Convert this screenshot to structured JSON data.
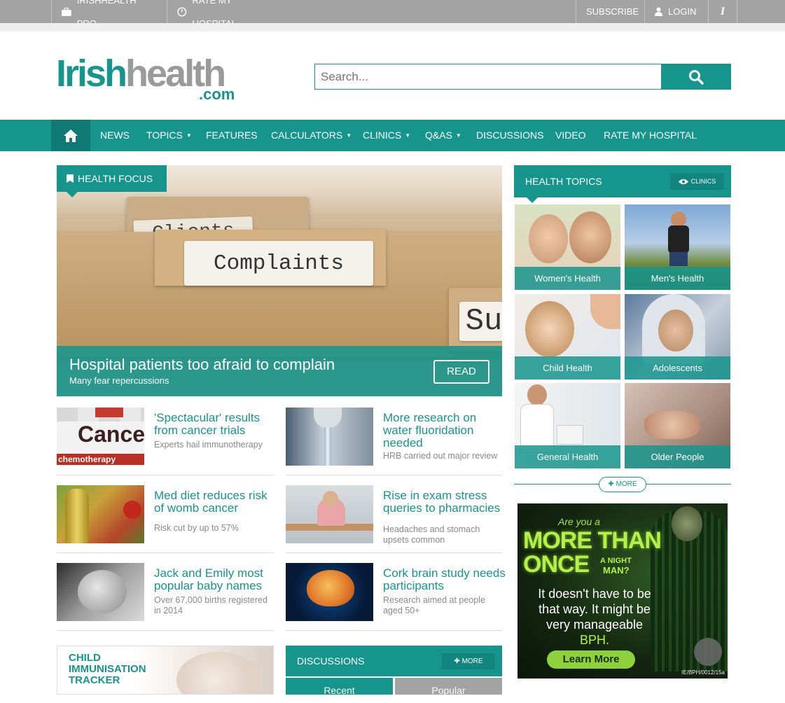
{
  "topbar": {
    "pro_label": "IRISHHEALTH PRO",
    "rate_label": "RATE MY HOSPITAL",
    "subscribe_label": "SUBSCRIBE",
    "login_label": "LOGIN",
    "info_label": "i"
  },
  "logo": {
    "part1": "Irish",
    "part2": "health",
    "dotcom": ".com"
  },
  "search": {
    "placeholder": "Search..."
  },
  "nav": {
    "items": [
      "NEWS",
      "TOPICS",
      "FEATURES",
      "CALCULATORS",
      "CLINICS",
      "Q&As",
      "DISCUSSIONS",
      "VIDEO",
      "RATE MY HOSPITAL"
    ]
  },
  "hero": {
    "badge": "HEALTH FOCUS",
    "folder_main": "Complaints",
    "folder_back": "Clients",
    "folder_side": "Su",
    "title": "Hospital patients too afraid to complain",
    "subtitle": "Many fear repercussions",
    "read_label": "READ"
  },
  "stories": [
    {
      "title": "'Spectacular' results from cancer trials",
      "sub": "Experts hail immunotherapy"
    },
    {
      "title": "More research on water fluoridation needed",
      "sub": "HRB carried out major review"
    },
    {
      "title": "Med diet reduces risk of womb cancer",
      "sub": "Risk cut by up to 57%"
    },
    {
      "title": "Rise in exam stress queries to pharmacies",
      "sub": "Headaches and stomach upsets common"
    },
    {
      "title": "Jack and Emily most popular baby names",
      "sub": "Over 67,000 births registered in 2014"
    },
    {
      "title": "Cork brain study needs participants",
      "sub": "Research aimed at people aged 50+"
    }
  ],
  "thumb_text": {
    "cancer": "Cancer",
    "chemo": "chemotherapy"
  },
  "tracker": {
    "label": "CHILD IMMUNISATION TRACKER"
  },
  "discussions": {
    "title": "DISCUSSIONS",
    "more_label": "MORE",
    "tab_recent": "Recent",
    "tab_popular": "Popular"
  },
  "health_topics": {
    "title": "HEALTH TOPICS",
    "clinics_label": "CLINICS",
    "tiles": [
      "Women's Health",
      "Men's Health",
      "Child Health",
      "Adolescents",
      "General Health",
      "Older People"
    ],
    "more_label": "MORE"
  },
  "ad": {
    "line1": "Are you a",
    "big1": "MORE THAN",
    "big2": "ONCE",
    "small1": "A NIGHT",
    "small2": "MAN?",
    "body": "It doesn't have to be that way. It might be very manageable",
    "body_highlight": "BPH.",
    "button": "Learn More",
    "code": "IE/BPH/0012/15a"
  },
  "colors": {
    "brand": "#16958d",
    "brand_dark": "#0f7a73",
    "topbar": "#a3a3a3",
    "tab_inactive": "#a3a3a3"
  }
}
